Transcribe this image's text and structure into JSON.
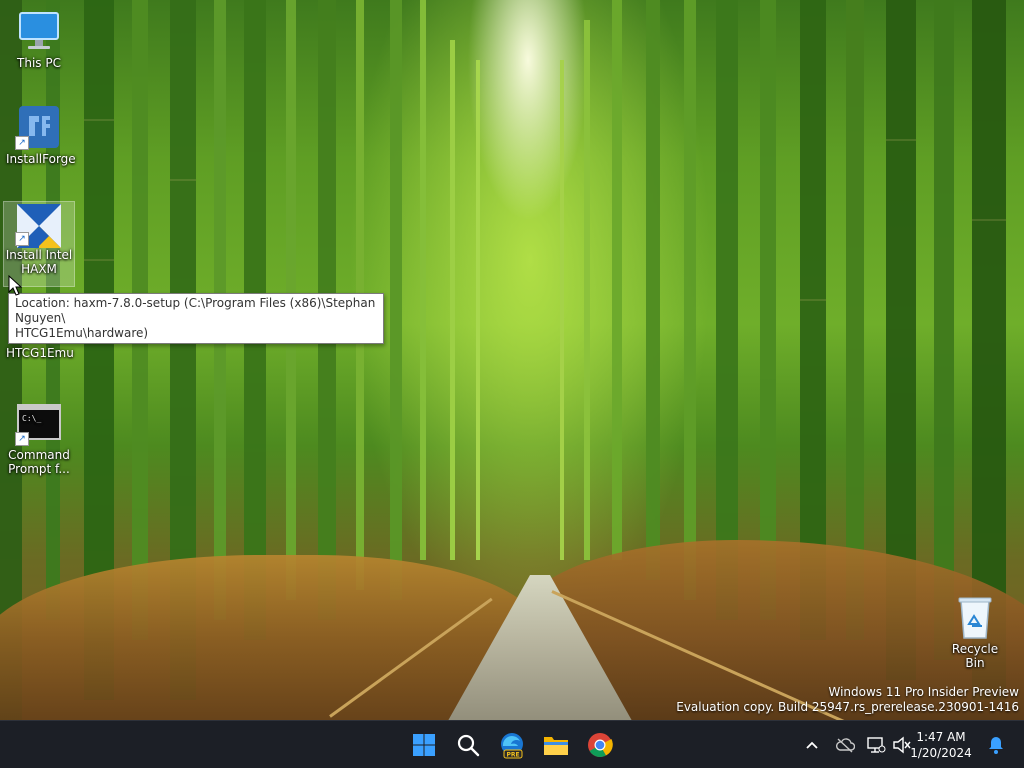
{
  "desktop_icons": [
    {
      "label": "This PC",
      "icon": "monitor-icon"
    },
    {
      "label": "InstallForge",
      "icon": "installforge-icon"
    },
    {
      "label": "Install Intel HAXM",
      "icon": "haxm-installer-icon"
    },
    {
      "label": "HTCG1Emu",
      "icon": "android-icon"
    },
    {
      "label": "Command Prompt f...",
      "icon": "cmd-icon"
    },
    {
      "label": "Recycle Bin",
      "icon": "recycle-bin-icon"
    }
  ],
  "tooltip": {
    "line1": "Location: haxm-7.8.0-setup (C:\\Program Files (x86)\\Stephan Nguyen\\",
    "line2": "HTCG1Emu\\hardware)"
  },
  "watermark": {
    "line1": "Windows 11 Pro Insider Preview",
    "line2": "Evaluation copy. Build 25947.rs_prerelease.230901-1416"
  },
  "taskbar": {
    "apps": [
      {
        "name": "Start",
        "icon": "windows-start-icon"
      },
      {
        "name": "Search",
        "icon": "search-icon"
      },
      {
        "name": "Microsoft Edge Preview",
        "icon": "edge-pre-icon",
        "badge": "PRE"
      },
      {
        "name": "File Explorer",
        "icon": "folder-icon"
      },
      {
        "name": "Google Chrome",
        "icon": "chrome-icon"
      }
    ],
    "tray": {
      "chevron": "^",
      "time": "1:47 AM",
      "date": "1/20/2024"
    }
  },
  "colors": {
    "taskbar_bg": "#1c1f26",
    "accent_blue": "#1e90ff"
  }
}
